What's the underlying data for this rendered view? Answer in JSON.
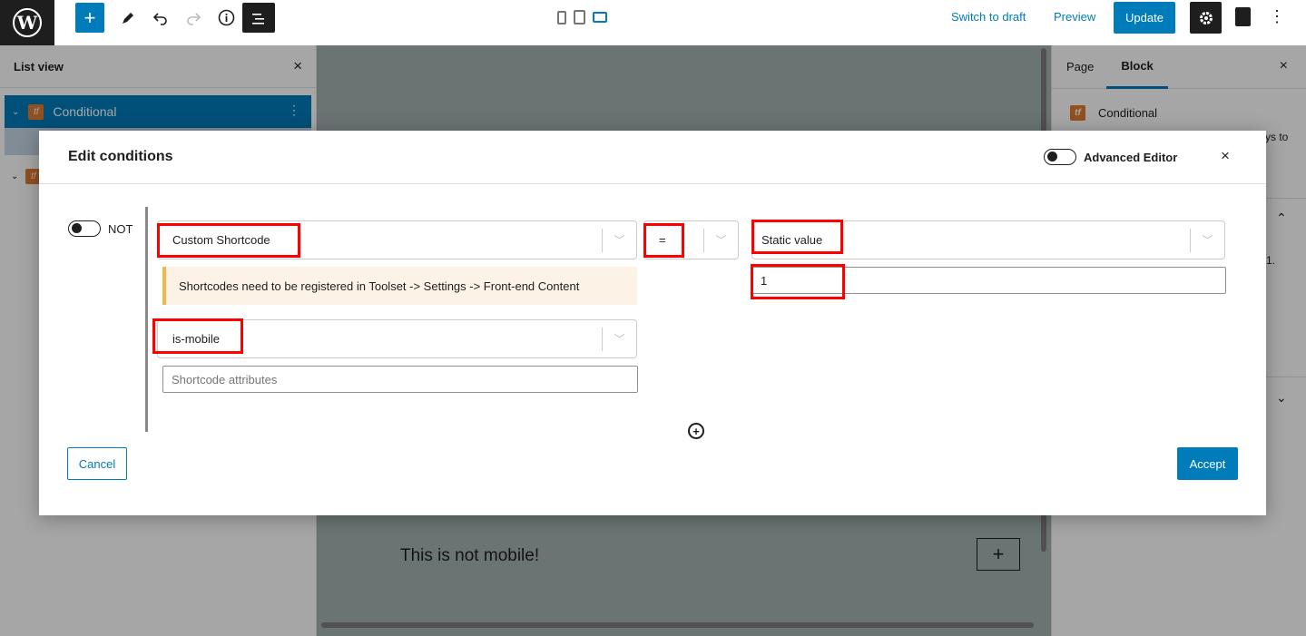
{
  "topbar": {
    "logo_letter": "W",
    "add_symbol": "+",
    "switch_to_draft": "Switch to draft",
    "preview": "Preview",
    "update": "Update",
    "more_symbol": "⋮",
    "accent": "#007cba"
  },
  "listview": {
    "title": "List view",
    "close": "×",
    "items": [
      {
        "label": "Conditional",
        "expanded": true,
        "selected": true
      }
    ],
    "more_symbol": "⋮"
  },
  "canvas": {
    "block_text": "This is not mobile!",
    "add_symbol": "+"
  },
  "sidebar": {
    "tabs": [
      {
        "label": "Page",
        "active": false
      },
      {
        "label": "Block",
        "active": true
      }
    ],
    "close": "×",
    "block_name": "Conditional",
    "fragment_1": "ys to",
    "fragment_2": "1."
  },
  "modal": {
    "title": "Edit conditions",
    "advanced_editor_label": "Advanced Editor",
    "advanced_editor_on": false,
    "close": "×",
    "not_label": "NOT",
    "not_on": false,
    "source_select": "Custom Shortcode",
    "operator_select": "=",
    "value_type_select": "Static value",
    "value_input": "1",
    "notice": "Shortcodes need to be registered in Toolset -> Settings -> Front-end Content",
    "shortcode_select": "is-mobile",
    "attributes_placeholder": "Shortcode attributes",
    "cancel": "Cancel",
    "accept": "Accept",
    "highlight_color": "#ff0000"
  }
}
